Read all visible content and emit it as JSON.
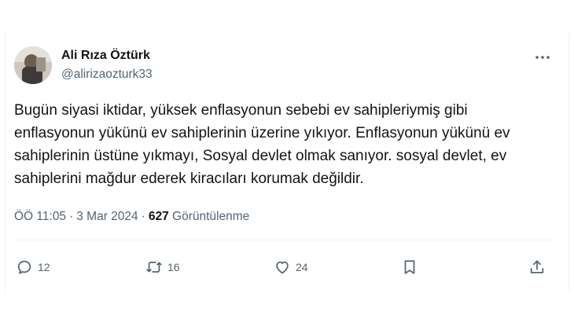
{
  "user": {
    "name": "Ali Rıza Öztürk",
    "handle": "@alirizaozturk33"
  },
  "tweet": {
    "text": "Bugün siyasi iktidar, yüksek enflasyonun sebebi ev sahipleriymiş gibi enflasyonun yükünü ev sahiplerinin üzerine yıkıyor. Enflasyonun yükünü ev sahiplerinin üstüne yıkmayı, Sosyal devlet olmak sanıyor. sosyal devlet, ev sahiplerini mağdur ederek kiracıları korumak değildir.",
    "time": "ÖÖ 11:05",
    "dot": "·",
    "date": "3 Mar 2024",
    "views_count": "627",
    "views_label": "Görüntülenme"
  },
  "actions": {
    "replies": "12",
    "retweets": "16",
    "likes": "24"
  },
  "icons": {
    "more": "more-dots-icon",
    "reply": "reply-icon",
    "retweet": "retweet-icon",
    "like": "heart-icon",
    "bookmark": "bookmark-icon",
    "share": "share-icon"
  },
  "colors": {
    "text": "#0f1419",
    "secondary": "#536471",
    "border": "#eff3f4"
  }
}
